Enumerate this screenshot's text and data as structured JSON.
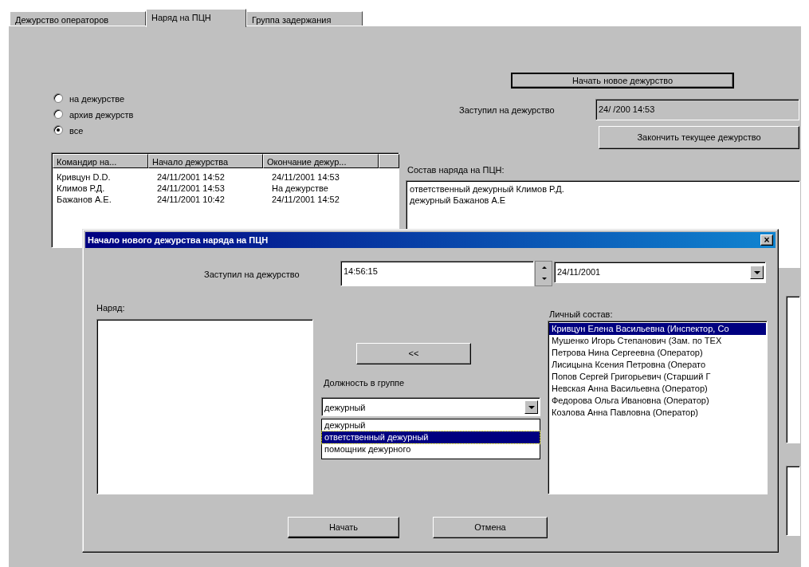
{
  "tabs": [
    {
      "label": "Дежурство операторов",
      "selected": false
    },
    {
      "label": "Наряд на ПЦН",
      "selected": true
    },
    {
      "label": "Группа задержания",
      "selected": false
    }
  ],
  "filter": [
    {
      "label": "на дежурстве",
      "selected": false
    },
    {
      "label": "архив дежурств",
      "selected": false
    },
    {
      "label": "все",
      "selected": true
    }
  ],
  "start_button": "Начать новое дежурство",
  "on_duty_label": "Заступил на дежурство",
  "on_duty_value": "24/  /200  14:53",
  "end_button": "Закончить текущее дежурство",
  "table": {
    "columns": [
      "Командир на...",
      "Начало дежурства",
      "Окончание дежур..."
    ],
    "rows": [
      [
        "Кривцун D.D.",
        "24/11/2001 14:52",
        "24/11/2001 14:53"
      ],
      [
        "Климов Р.Д.",
        "24/11/2001 14:53",
        "На дежурстве"
      ],
      [
        "Бажанов А.Е.",
        "24/11/2001 10:42",
        "24/11/2001 14:52"
      ]
    ]
  },
  "crew_label": "Состав наряда на ПЦН:",
  "crew_lines": [
    "ответственный дежурный Климов Р.Д.",
    "дежурный Бажанов А.Е"
  ],
  "dialog": {
    "title": "Начало нового дежурства наряда на ПЦН",
    "close": "×",
    "start_label": "Заступил на дежурство",
    "time": "14:56:15",
    "date": "24/11/2001",
    "crew_list_label": "Наряд:",
    "move_button": "<<",
    "position_label": "Должность в группе",
    "position_value": "дежурный",
    "position_options": [
      {
        "label": "дежурный",
        "selected": false
      },
      {
        "label": "ответственный дежурный",
        "selected": true
      },
      {
        "label": "помощник дежурного",
        "selected": false
      }
    ],
    "staff_label": "Личный состав:",
    "staff": [
      {
        "label": "Кривцун Елена Васильевна (Инспектор, Со",
        "selected": true
      },
      {
        "label": "Мушенко Игорь Степанович (Зам. по ТЕХ",
        "selected": false
      },
      {
        "label": "Петрова Нина Сергеевна (Оператор)",
        "selected": false
      },
      {
        "label": "Лисицына Ксения Петровна (Операто",
        "selected": false
      },
      {
        "label": "Попов Сергей Григорьевич (Старший Г",
        "selected": false
      },
      {
        "label": "Невская Анна Васильевна (Оператор)",
        "selected": false
      },
      {
        "label": "Федорова Ольга Ивановна (Оператор)",
        "selected": false
      },
      {
        "label": "Козлова Анна Павловна (Оператор)",
        "selected": false
      }
    ],
    "buttons": [
      "Начать",
      "Отмена"
    ]
  }
}
